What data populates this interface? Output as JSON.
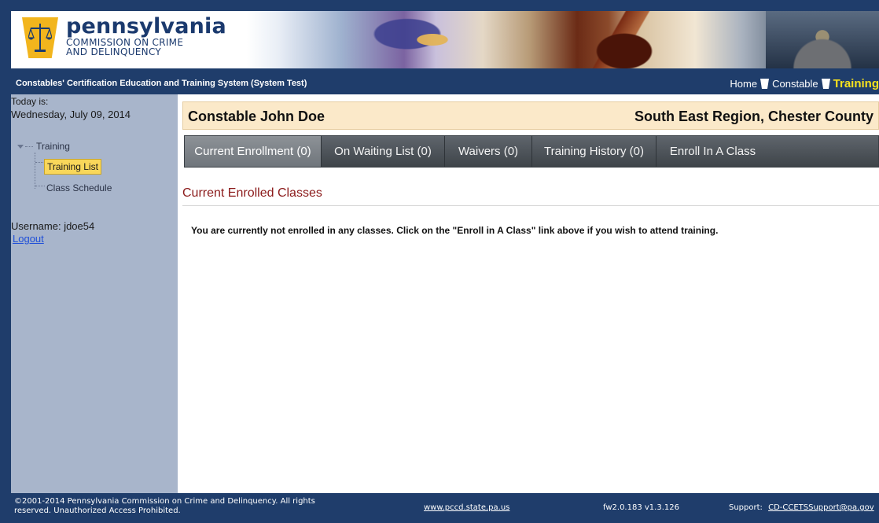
{
  "header": {
    "logo_title": "pennsylvania",
    "logo_subtitle_1": "COMMISSION ON CRIME",
    "logo_subtitle_2": "AND DELINQUENCY"
  },
  "navbar": {
    "system_name": "Constables' Certification Education and Training System (System Test)",
    "links": [
      {
        "label": "Home"
      },
      {
        "label": "Constable"
      },
      {
        "label": "Training"
      }
    ],
    "active_color": "#f7e21e"
  },
  "sidebar": {
    "today_label": "Today is:",
    "today_date": "Wednesday, July 09, 2014",
    "tree": {
      "root": "Training",
      "items": [
        {
          "label": "Training List",
          "selected": true
        },
        {
          "label": "Class Schedule",
          "selected": false
        }
      ]
    },
    "username": "Username: jdoe54",
    "logout": "Logout"
  },
  "main": {
    "constable_name": "Constable John Doe",
    "region": "South East Region, Chester County",
    "tabs": [
      {
        "label": "Current Enrollment (0)",
        "active": true
      },
      {
        "label": "On Waiting List (0)",
        "active": false
      },
      {
        "label": "Waivers (0)",
        "active": false
      },
      {
        "label": "Training History (0)",
        "active": false
      },
      {
        "label": "Enroll In A Class",
        "active": false
      }
    ],
    "section_title": "Current Enrolled Classes",
    "message": "You are currently not enrolled in any classes. Click on the \"Enroll in A Class\" link above if you wish to attend training."
  },
  "footer": {
    "copyright": "©2001-2014 Pennsylvania Commission on Crime and Delinquency. All rights reserved. Unauthorized Access Prohibited.",
    "site": "www.pccd.state.pa.us",
    "version": "fw2.0.183 v1.3.126",
    "support_label": "Support:",
    "support_email": "CD-CCETSSupport@pa.gov"
  },
  "colors": {
    "navy": "#1f3d6b",
    "sidebar": "#a8b5cb",
    "name_bar": "#fbe9c9",
    "section_title": "#8b1a1a",
    "selected_item": "#f9d75a"
  }
}
